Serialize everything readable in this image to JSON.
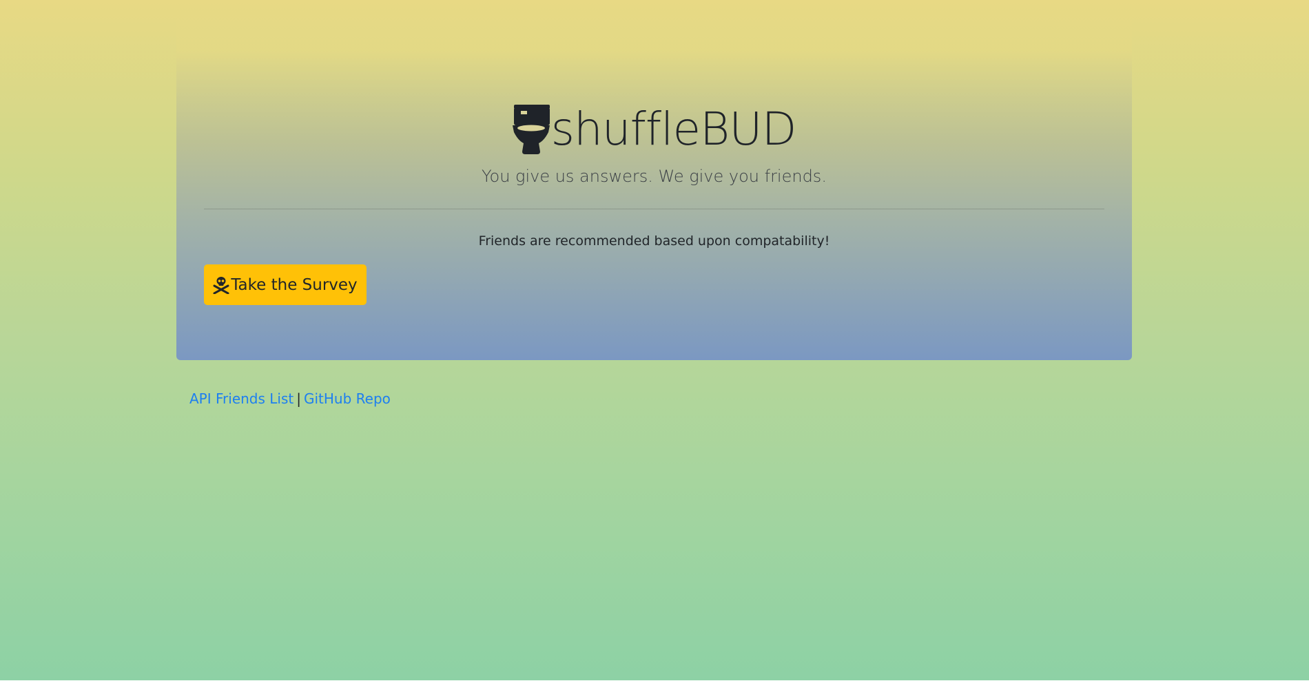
{
  "header": {
    "icon": "toilet-icon",
    "title": "shuffleBUD",
    "subtitle": "You give us answers. We give you friends."
  },
  "main": {
    "lead": "Friends are recommended based upon compatability!",
    "survey_button": {
      "icon": "skull-crossbones-icon",
      "label": "Take the Survey"
    }
  },
  "footer": {
    "api_link": "API Friends List",
    "separator": "|",
    "github_link": "GitHub Repo"
  },
  "colors": {
    "button": "#ffc107",
    "link": "#1d7ff0",
    "text": "#212529"
  }
}
